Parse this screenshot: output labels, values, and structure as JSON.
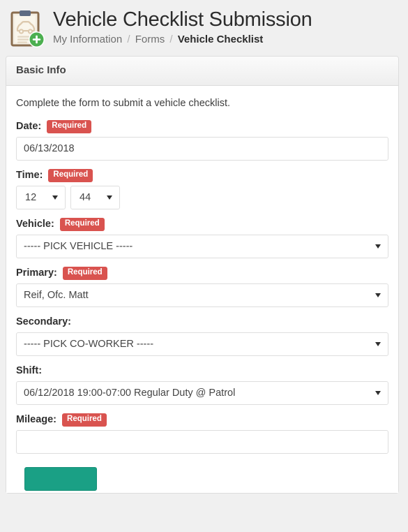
{
  "header": {
    "icon": "clipboard-car-add-icon",
    "title": "Vehicle Checklist Submission",
    "breadcrumb": [
      {
        "label": "My Information",
        "active": false
      },
      {
        "label": "Forms",
        "active": false
      },
      {
        "label": "Vehicle Checklist",
        "active": true
      }
    ],
    "breadcrumb_separator": "/"
  },
  "panel": {
    "heading": "Basic Info",
    "intro": "Complete the form to submit a vehicle checklist.",
    "required_badge_label": "Required",
    "fields": {
      "date": {
        "label": "Date:",
        "required": true,
        "value": "06/13/2018",
        "placeholder": ""
      },
      "time": {
        "label": "Time:",
        "required": true,
        "hour": "12",
        "minute": "44"
      },
      "vehicle": {
        "label": "Vehicle:",
        "required": true,
        "value": "----- PICK VEHICLE -----"
      },
      "primary": {
        "label": "Primary:",
        "required": true,
        "value": "Reif, Ofc. Matt"
      },
      "secondary": {
        "label": "Secondary:",
        "required": false,
        "value": "----- PICK CO-WORKER -----"
      },
      "shift": {
        "label": "Shift:",
        "required": false,
        "value": "06/12/2018 19:00-07:00 Regular Duty @ Patrol"
      },
      "mileage": {
        "label": "Mileage:",
        "required": true,
        "value": "",
        "placeholder": ""
      }
    },
    "submit_label": ""
  },
  "colors": {
    "page_background": "#f0f0f0",
    "panel_background": "#ffffff",
    "panel_border": "#dddddd",
    "required_badge": "#d9534f",
    "submit_button": "#1aa085",
    "icon_badge_green": "#4caf50",
    "icon_clipboard_brown": "#8a6d4f"
  }
}
